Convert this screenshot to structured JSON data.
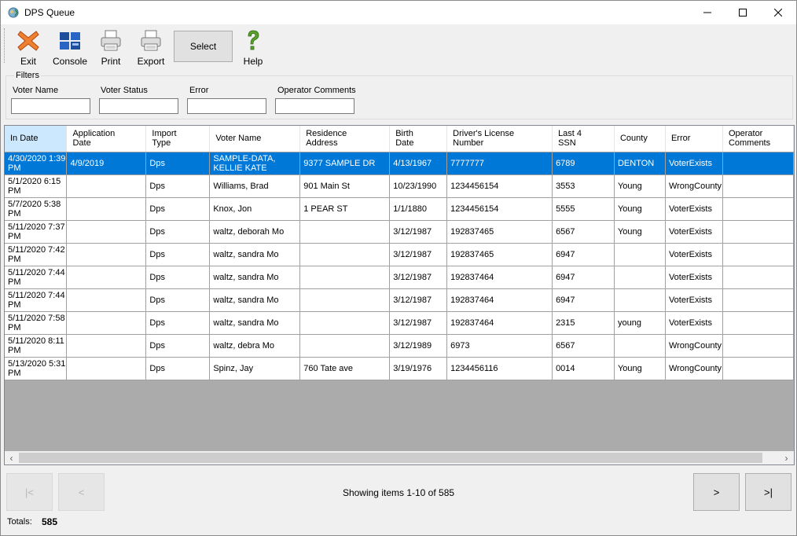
{
  "window": {
    "title": "DPS Queue"
  },
  "toolbar": {
    "exit": "Exit",
    "console": "Console",
    "print": "Print",
    "export": "Export",
    "select": "Select",
    "help": "Help"
  },
  "filters": {
    "legend": "Filters",
    "voter_name_label": "Voter Name",
    "voter_status_label": "Voter Status",
    "error_label": "Error",
    "operator_comments_label": "Operator Comments"
  },
  "table": {
    "columns": [
      {
        "line1": "In Date",
        "line2": ""
      },
      {
        "line1": "Application",
        "line2": "Date"
      },
      {
        "line1": "Import",
        "line2": "Type"
      },
      {
        "line1": "Voter Name",
        "line2": ""
      },
      {
        "line1": "Residence",
        "line2": "Address"
      },
      {
        "line1": "Birth",
        "line2": "Date"
      },
      {
        "line1": "Driver's License",
        "line2": "Number"
      },
      {
        "line1": "Last 4",
        "line2": "SSN"
      },
      {
        "line1": "County",
        "line2": ""
      },
      {
        "line1": "Error",
        "line2": ""
      },
      {
        "line1": "Operator",
        "line2": "Comments"
      }
    ],
    "rows": [
      {
        "in_date": "4/30/2020 1:39 PM",
        "app_date": "4/9/2019",
        "import_type": "Dps",
        "voter_name": "SAMPLE-DATA, KELLIE KATE",
        "address": "9377 SAMPLE DR",
        "birth_date": "4/13/1967",
        "dl": "7777777",
        "ssn": "6789",
        "county": "DENTON",
        "error": "VoterExists",
        "comments": ""
      },
      {
        "in_date": "5/1/2020 6:15 PM",
        "app_date": "",
        "import_type": "Dps",
        "voter_name": "Williams, Brad",
        "address": "901 Main St",
        "birth_date": "10/23/1990",
        "dl": "1234456154",
        "ssn": "3553",
        "county": "Young",
        "error": "WrongCounty",
        "comments": ""
      },
      {
        "in_date": "5/7/2020 5:38 PM",
        "app_date": "",
        "import_type": "Dps",
        "voter_name": "Knox, Jon",
        "address": "1 PEAR ST",
        "birth_date": "1/1/1880",
        "dl": "1234456154",
        "ssn": "5555",
        "county": "Young",
        "error": "VoterExists",
        "comments": ""
      },
      {
        "in_date": "5/11/2020 7:37 PM",
        "app_date": "",
        "import_type": "Dps",
        "voter_name": "waltz, deborah Mo",
        "address": "",
        "birth_date": "3/12/1987",
        "dl": "192837465",
        "ssn": "6567",
        "county": "Young",
        "error": "VoterExists",
        "comments": ""
      },
      {
        "in_date": "5/11/2020 7:42 PM",
        "app_date": "",
        "import_type": "Dps",
        "voter_name": "waltz, sandra Mo",
        "address": "",
        "birth_date": "3/12/1987",
        "dl": "192837465",
        "ssn": "6947",
        "county": "",
        "error": "VoterExists",
        "comments": ""
      },
      {
        "in_date": "5/11/2020 7:44 PM",
        "app_date": "",
        "import_type": "Dps",
        "voter_name": "waltz, sandra Mo",
        "address": "",
        "birth_date": "3/12/1987",
        "dl": "192837464",
        "ssn": "6947",
        "county": "",
        "error": "VoterExists",
        "comments": ""
      },
      {
        "in_date": "5/11/2020 7:44 PM",
        "app_date": "",
        "import_type": "Dps",
        "voter_name": "waltz, sandra Mo",
        "address": "",
        "birth_date": "3/12/1987",
        "dl": "192837464",
        "ssn": "6947",
        "county": "",
        "error": "VoterExists",
        "comments": ""
      },
      {
        "in_date": "5/11/2020 7:58 PM",
        "app_date": "",
        "import_type": "Dps",
        "voter_name": "waltz, sandra Mo",
        "address": "",
        "birth_date": "3/12/1987",
        "dl": "192837464",
        "ssn": "2315",
        "county": "young",
        "error": "VoterExists",
        "comments": ""
      },
      {
        "in_date": "5/11/2020 8:11 PM",
        "app_date": "",
        "import_type": "Dps",
        "voter_name": "waltz, debra Mo",
        "address": "",
        "birth_date": "3/12/1989",
        "dl": "6973",
        "ssn": "6567",
        "county": "",
        "error": "WrongCounty",
        "comments": ""
      },
      {
        "in_date": "5/13/2020 5:31 PM",
        "app_date": "",
        "import_type": "Dps",
        "voter_name": "Spinz, Jay",
        "address": "760 Tate ave",
        "birth_date": "3/19/1976",
        "dl": "1234456116",
        "ssn": "0014",
        "county": "Young",
        "error": "WrongCounty",
        "comments": ""
      }
    ]
  },
  "pager": {
    "first": "|<",
    "prev": "<",
    "next": ">",
    "last": ">|",
    "status": "Showing items 1-10 of 585"
  },
  "footer": {
    "totals_label": "Totals:",
    "totals_value": "585"
  },
  "colors": {
    "selection": "#0078d7",
    "header_selected": "#cce8ff",
    "grid_empty": "#ababab"
  }
}
